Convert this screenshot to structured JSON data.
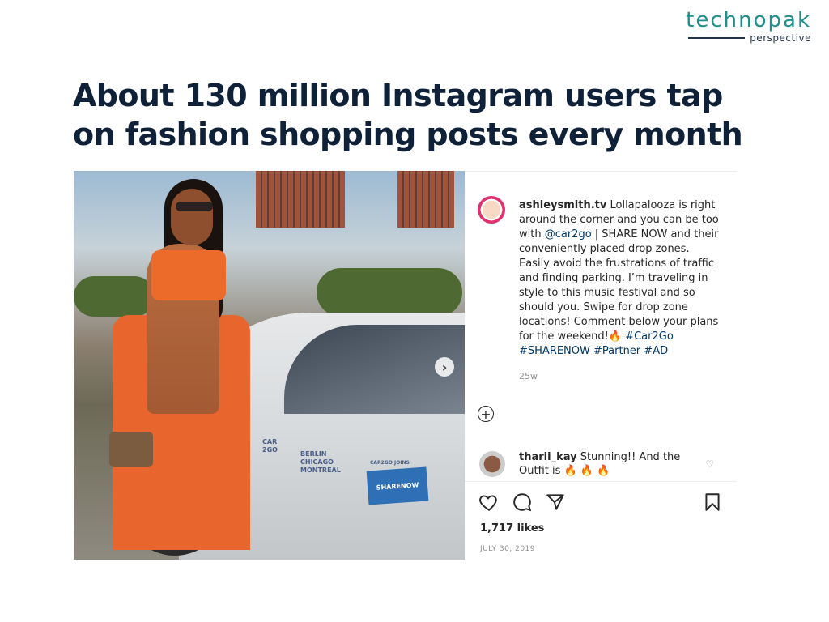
{
  "brand": {
    "name": "technopak",
    "tagline": "perspective",
    "accent": "#1f8f8a",
    "dark": "#0f2138"
  },
  "slide": {
    "headline": "About 130 million Instagram users tap on fashion shopping posts every month"
  },
  "post": {
    "caption": {
      "username": "ashleysmith.tv",
      "text_before_mention": " Lollapalooza is right around the corner and you can be too with ",
      "mention": "@car2go",
      "text_after_mention": " | SHARE NOW and their conveniently placed drop zones. Easily avoid the frustrations of traffic and finding parking. I’m traveling in style to this music festival and so should you. Swipe for drop zone locations! Comment below your plans for the weekend!",
      "emoji": "🔥",
      "hashtags": [
        "#Car2Go",
        "#SHARENOW",
        "#Partner",
        "#AD"
      ]
    },
    "time_ago": "25w",
    "comment": {
      "username": "tharii_kay",
      "text": "Stunning!! And the Outfit is",
      "emojis": "🔥 🔥 🔥"
    },
    "likes": "1,717 likes",
    "date": "JULY 30, 2019",
    "image": {
      "decal_lines": [
        "CAR",
        "2GO"
      ],
      "decal_cities": [
        "BERLIN",
        "CHICAGO",
        "MONTREAL"
      ],
      "decal_small": "CAR2GO JOINS",
      "badge": "SHARENOW"
    },
    "icons": {
      "next": "chevron-right-icon",
      "add": "plus-circle-icon",
      "like": "heart-icon",
      "comment": "comment-icon",
      "share": "send-icon",
      "save": "bookmark-icon",
      "comment_like": "small-heart-icon"
    }
  }
}
